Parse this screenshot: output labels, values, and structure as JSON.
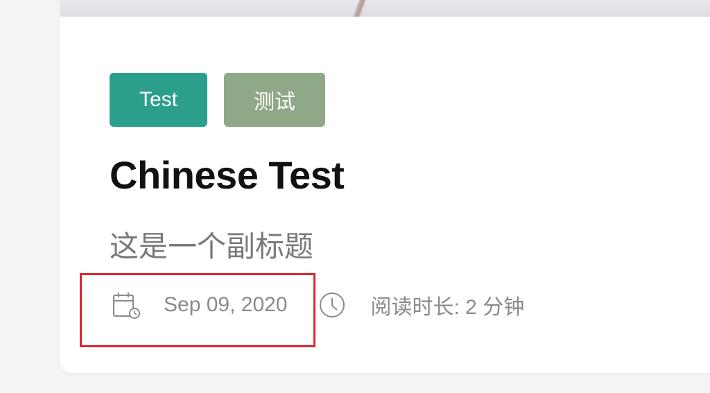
{
  "post": {
    "tags": [
      "Test",
      "测试"
    ],
    "title": "Chinese Test",
    "subtitle": "这是一个副标题",
    "date": "Sep 09, 2020",
    "read_time": "阅读时长: 2 分钟"
  },
  "icons": {
    "date": "calendar-icon",
    "read_time": "clock-icon"
  },
  "colors": {
    "tag_test": "#2b9e8c",
    "tag_cn": "#8fa887",
    "highlight": "#e0262d"
  }
}
